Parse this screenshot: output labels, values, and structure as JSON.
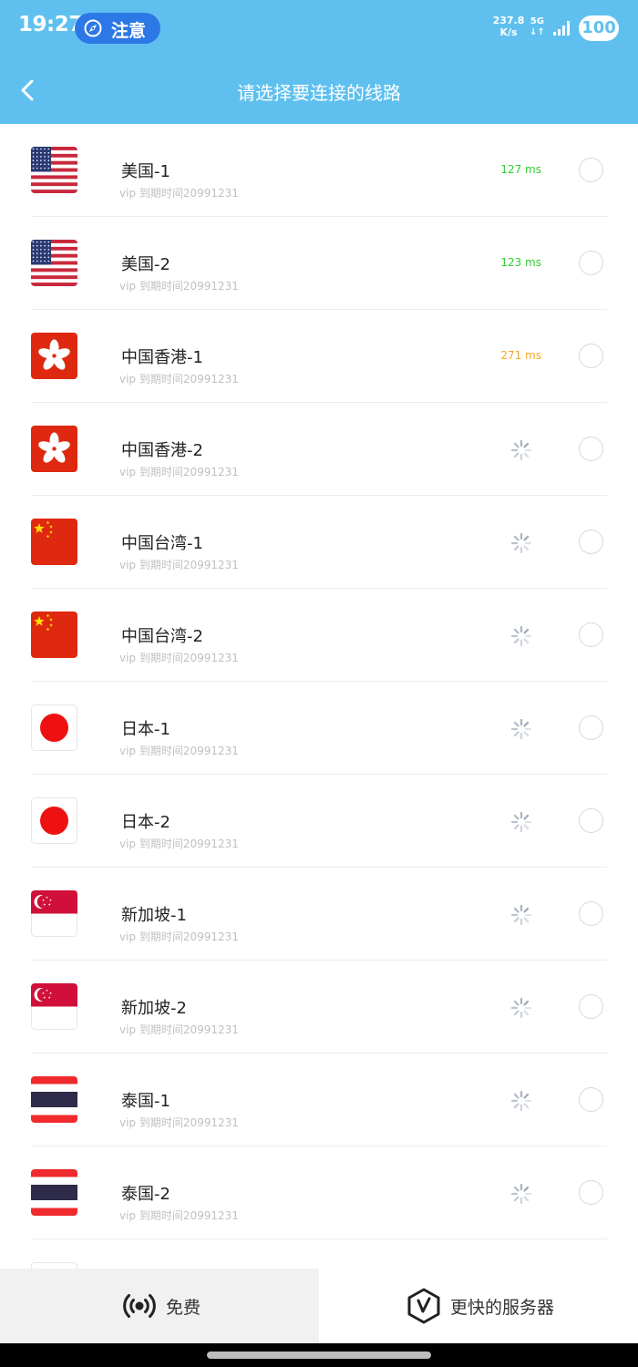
{
  "status_bar": {
    "time": "19:27",
    "notice": "注意",
    "net_speed_value": "237.8",
    "net_speed_unit": "K/s",
    "net_type": "5G",
    "battery": "100"
  },
  "header": {
    "title": "请选择要连接的线路",
    "back_icon": "chevron-left-icon"
  },
  "servers": [
    {
      "name": "美国-1",
      "sub": "vip  到期时间20991231",
      "flag": "us",
      "latency": "127 ms",
      "latency_color": "#33cc33",
      "status": "latency"
    },
    {
      "name": "美国-2",
      "sub": "vip  到期时间20991231",
      "flag": "us",
      "latency": "123 ms",
      "latency_color": "#33cc33",
      "status": "latency"
    },
    {
      "name": "中国香港-1",
      "sub": "vip  到期时间20991231",
      "flag": "hk",
      "latency": "271 ms",
      "latency_color": "#f5a623",
      "status": "latency"
    },
    {
      "name": "中国香港-2",
      "sub": "vip  到期时间20991231",
      "flag": "hk",
      "status": "loading"
    },
    {
      "name": "中国台湾-1",
      "sub": "vip  到期时间20991231",
      "flag": "cn",
      "status": "loading"
    },
    {
      "name": "中国台湾-2",
      "sub": "vip  到期时间20991231",
      "flag": "cn",
      "status": "loading"
    },
    {
      "name": "日本-1",
      "sub": "vip  到期时间20991231",
      "flag": "jp",
      "status": "loading"
    },
    {
      "name": "日本-2",
      "sub": "vip  到期时间20991231",
      "flag": "jp",
      "status": "loading"
    },
    {
      "name": "新加坡-1",
      "sub": "vip  到期时间20991231",
      "flag": "sg",
      "status": "loading"
    },
    {
      "name": "新加坡-2",
      "sub": "vip  到期时间20991231",
      "flag": "sg",
      "status": "loading"
    },
    {
      "name": "泰国-1",
      "sub": "vip  到期时间20991231",
      "flag": "th",
      "status": "loading"
    },
    {
      "name": "泰国-2",
      "sub": "vip  到期时间20991231",
      "flag": "th",
      "status": "loading"
    }
  ],
  "tabs": {
    "free_label": "免费",
    "free_icon": "broadcast-icon",
    "fast_label": "更快的服务器",
    "fast_icon": "hexagon-v-icon"
  },
  "colors": {
    "header_bg": "#5fc0ef",
    "latency_good": "#33cc33",
    "latency_medium": "#f5a623"
  }
}
